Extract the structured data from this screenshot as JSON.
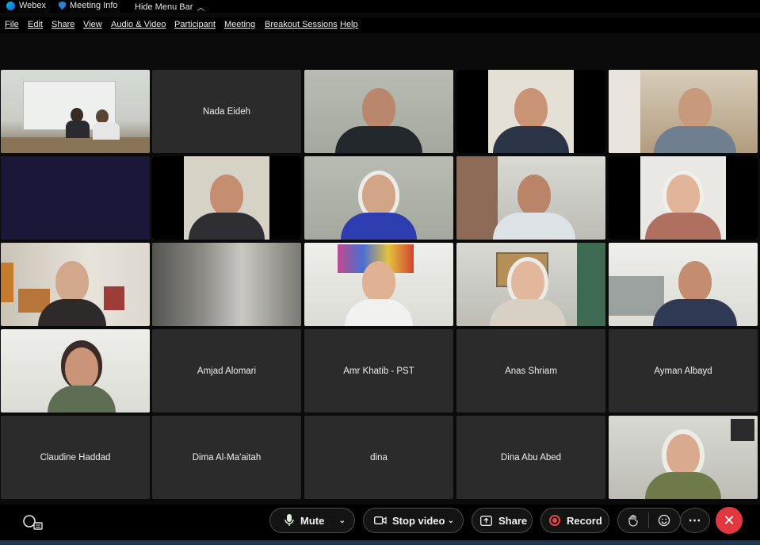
{
  "titlebar": {
    "app_name": "Webex",
    "meeting_info": "Meeting Info",
    "hide_menu": "Hide Menu Bar"
  },
  "menu": [
    "File",
    "Edit",
    "Share",
    "View",
    "Audio & Video",
    "Participant",
    "Meeting",
    "Breakout Sessions",
    "Help"
  ],
  "participants": {
    "nada": "Nada Eideh",
    "amjad": "Amjad Alomari",
    "amr": "Amr Khatib - PST",
    "anas": "Anas Shriam",
    "ayman": "Ayman Albayd",
    "claudine": "Claudine Haddad",
    "dima": "Dima Al-Ma'aitah",
    "dina": "dina",
    "dina_abu": "Dina Abu Abed"
  },
  "controls": {
    "mute": "Mute",
    "stop_video": "Stop video",
    "share": "Share",
    "record": "Record"
  },
  "colors": {
    "end_button": "#e0383e",
    "record_icon": "#e8454b",
    "tile": "#2b2b2b"
  }
}
